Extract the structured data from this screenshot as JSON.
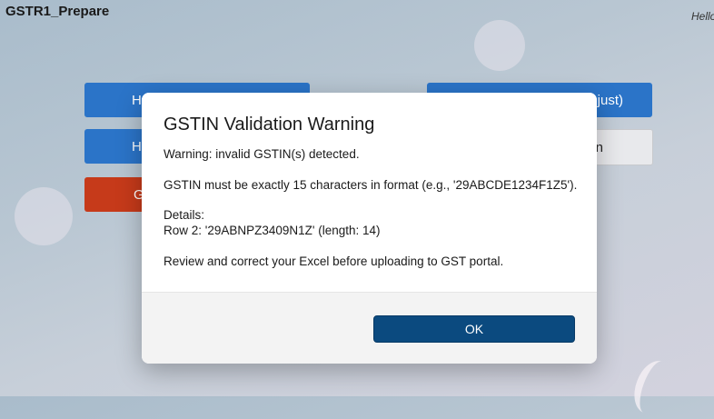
{
  "app": {
    "title": "GSTR1_Prepare",
    "greeting": "Hello"
  },
  "background_buttons": [
    {
      "label": "H",
      "color": "#2b74c8"
    },
    {
      "label": "H",
      "color": "#2b74c8"
    },
    {
      "label": "G",
      "color": "#c63a1a"
    },
    {
      "label": "just)",
      "color": "#2b74c8"
    },
    {
      "label": "n",
      "color": "#e8e9ec"
    }
  ],
  "dialog": {
    "title": "GSTIN Validation Warning",
    "warning": "Warning: invalid GSTIN(s) detected.",
    "rule": "GSTIN must be exactly 15 characters in format (e.g., '29ABCDE1234F1Z5').",
    "details_label": "Details:",
    "detail_row": "Row 2: '29ABNPZ3409N1Z' (length: 14)",
    "advice": "Review and correct your Excel before uploading to GST portal.",
    "ok_label": "OK"
  },
  "colors": {
    "accent": "#0b4a7f",
    "primary_button": "#2b74c8",
    "danger_button": "#c63a1a"
  }
}
